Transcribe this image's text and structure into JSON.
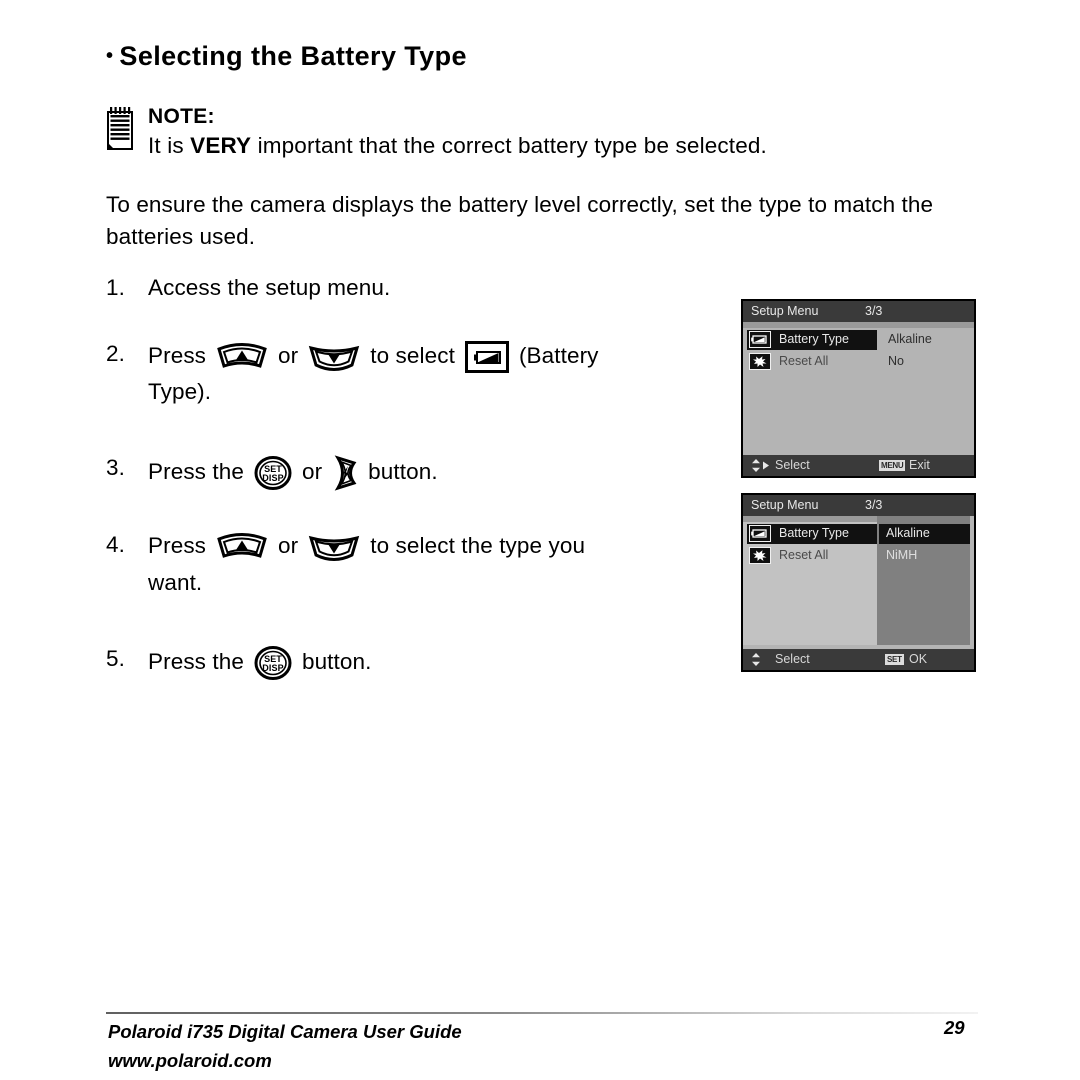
{
  "page": {
    "heading_bullet": "•",
    "heading": "Selecting the Battery Type"
  },
  "note": {
    "icon": "notepad-icon",
    "title": "NOTE:",
    "text_before": "It is ",
    "emphasis": "VERY",
    "text_after": " important that the correct battery type be selected."
  },
  "intro": {
    "text": "To ensure the camera displays the battery level correctly, set the type to match the batteries used."
  },
  "steps": [
    {
      "num": "1.",
      "line1": "Access the setup menu.",
      "line2": ""
    },
    {
      "num": "2.",
      "frag_a": "Press",
      "icon_up": "up-arrow-button-icon",
      "frag_b": "or",
      "icon_down": "down-arrow-button-icon",
      "frag_c": "to  select",
      "icon_battery": "battery-type-icon",
      "frag_d": "(Battery",
      "line2": "Type)."
    },
    {
      "num": "3.",
      "frag_a": "Press the",
      "icon_set": "set-disp-button-icon",
      "frag_b": "or",
      "icon_flash": "flash-right-button-icon",
      "frag_c": "button.",
      "line2": ""
    },
    {
      "num": "4.",
      "frag_a": "Press",
      "icon_up": "up-arrow-button-icon",
      "frag_b": "or",
      "icon_down": "down-arrow-button-icon",
      "frag_c": "to  select  the  type  you",
      "line2": "want."
    },
    {
      "num": "5.",
      "frag_a": "Press the",
      "icon_set": "set-disp-button-icon",
      "frag_b": "button.",
      "line2": ""
    }
  ],
  "set_button_label": {
    "top": "SET",
    "bottom": "DISP"
  },
  "lcd_screens": [
    {
      "id": "setup-menu-screen-1",
      "title": "Setup Menu",
      "page_indicator": "3/3",
      "rows": [
        {
          "label": "Battery Type",
          "icon": "battery-icon",
          "value": "Alkaline",
          "selected": true
        },
        {
          "label": "Reset All",
          "icon": "reset-icon",
          "value": "No",
          "selected": false
        }
      ],
      "footer": {
        "nav_icon": "updown-right-arrows-icon",
        "nav_label": "Select",
        "action_badge": "MENU",
        "action_label": "Exit"
      },
      "dropdown_open": false
    },
    {
      "id": "setup-menu-screen-2",
      "title": "Setup Menu",
      "page_indicator": "3/3",
      "rows": [
        {
          "label": "Battery Type",
          "icon": "battery-icon",
          "value": "Alkaline",
          "selected": true
        },
        {
          "label": "Reset All",
          "icon": "reset-icon",
          "value": "NiMH",
          "selected": false
        }
      ],
      "footer": {
        "nav_icon": "updown-arrows-icon",
        "nav_label": "Select",
        "action_badge": "SET",
        "action_label": "OK"
      },
      "dropdown_open": true
    }
  ],
  "footer": {
    "line1": "Polaroid i735 Digital Camera User Guide",
    "line2": "www.polaroid.com",
    "page_number": "29"
  },
  "colors": {
    "lcd_background": "#b4b4b4",
    "lcd_titlebar": "#3a3a3a",
    "lcd_highlight": "#111111",
    "lcd_right_pane": "#808080",
    "text": "#000000"
  }
}
